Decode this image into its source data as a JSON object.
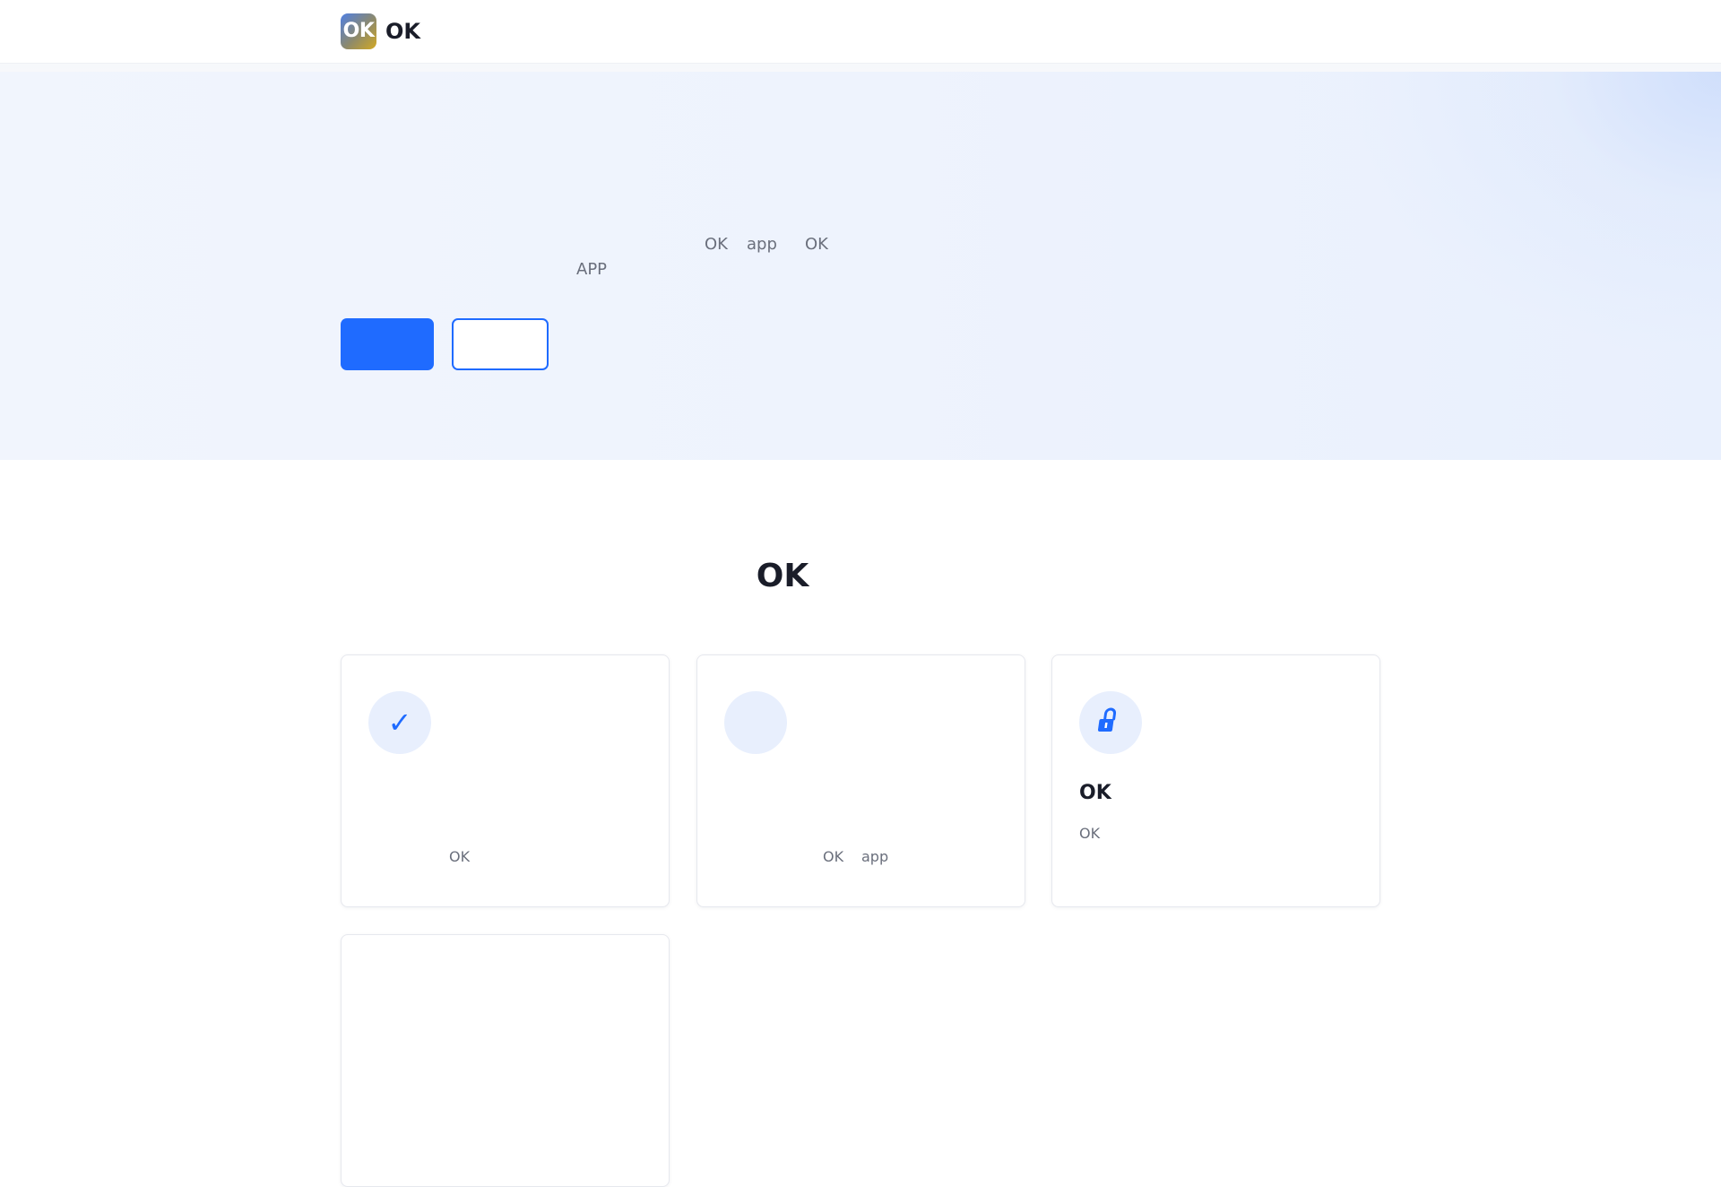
{
  "header": {
    "logo_text": "OK",
    "brand": "OK"
  },
  "hero": {
    "text_1": "OK",
    "text_2": "app",
    "text_3": "OK",
    "text_4": "APP",
    "primary_button_label": "",
    "secondary_button_label": ""
  },
  "section": {
    "title": "OK"
  },
  "cards": [
    {
      "icon": "check-icon",
      "icon_glyph": "✓",
      "title": "",
      "text_1": "OK",
      "text_2": ""
    },
    {
      "icon": "blank-icon",
      "icon_glyph": "",
      "title": "",
      "text_1": "OK",
      "text_2": "app"
    },
    {
      "icon": "lock-icon",
      "icon_glyph": "",
      "title": "OK",
      "text_1": "OK",
      "text_2": ""
    },
    {
      "icon": "",
      "icon_glyph": "",
      "title": "",
      "text_1": "",
      "text_2": ""
    }
  ],
  "colors": {
    "accent": "#1f6bff",
    "hero_bg": "#eef3fd",
    "icon_bg": "#e8effd",
    "text_muted": "#6a6f7c",
    "text_dark": "#1a1d29"
  }
}
